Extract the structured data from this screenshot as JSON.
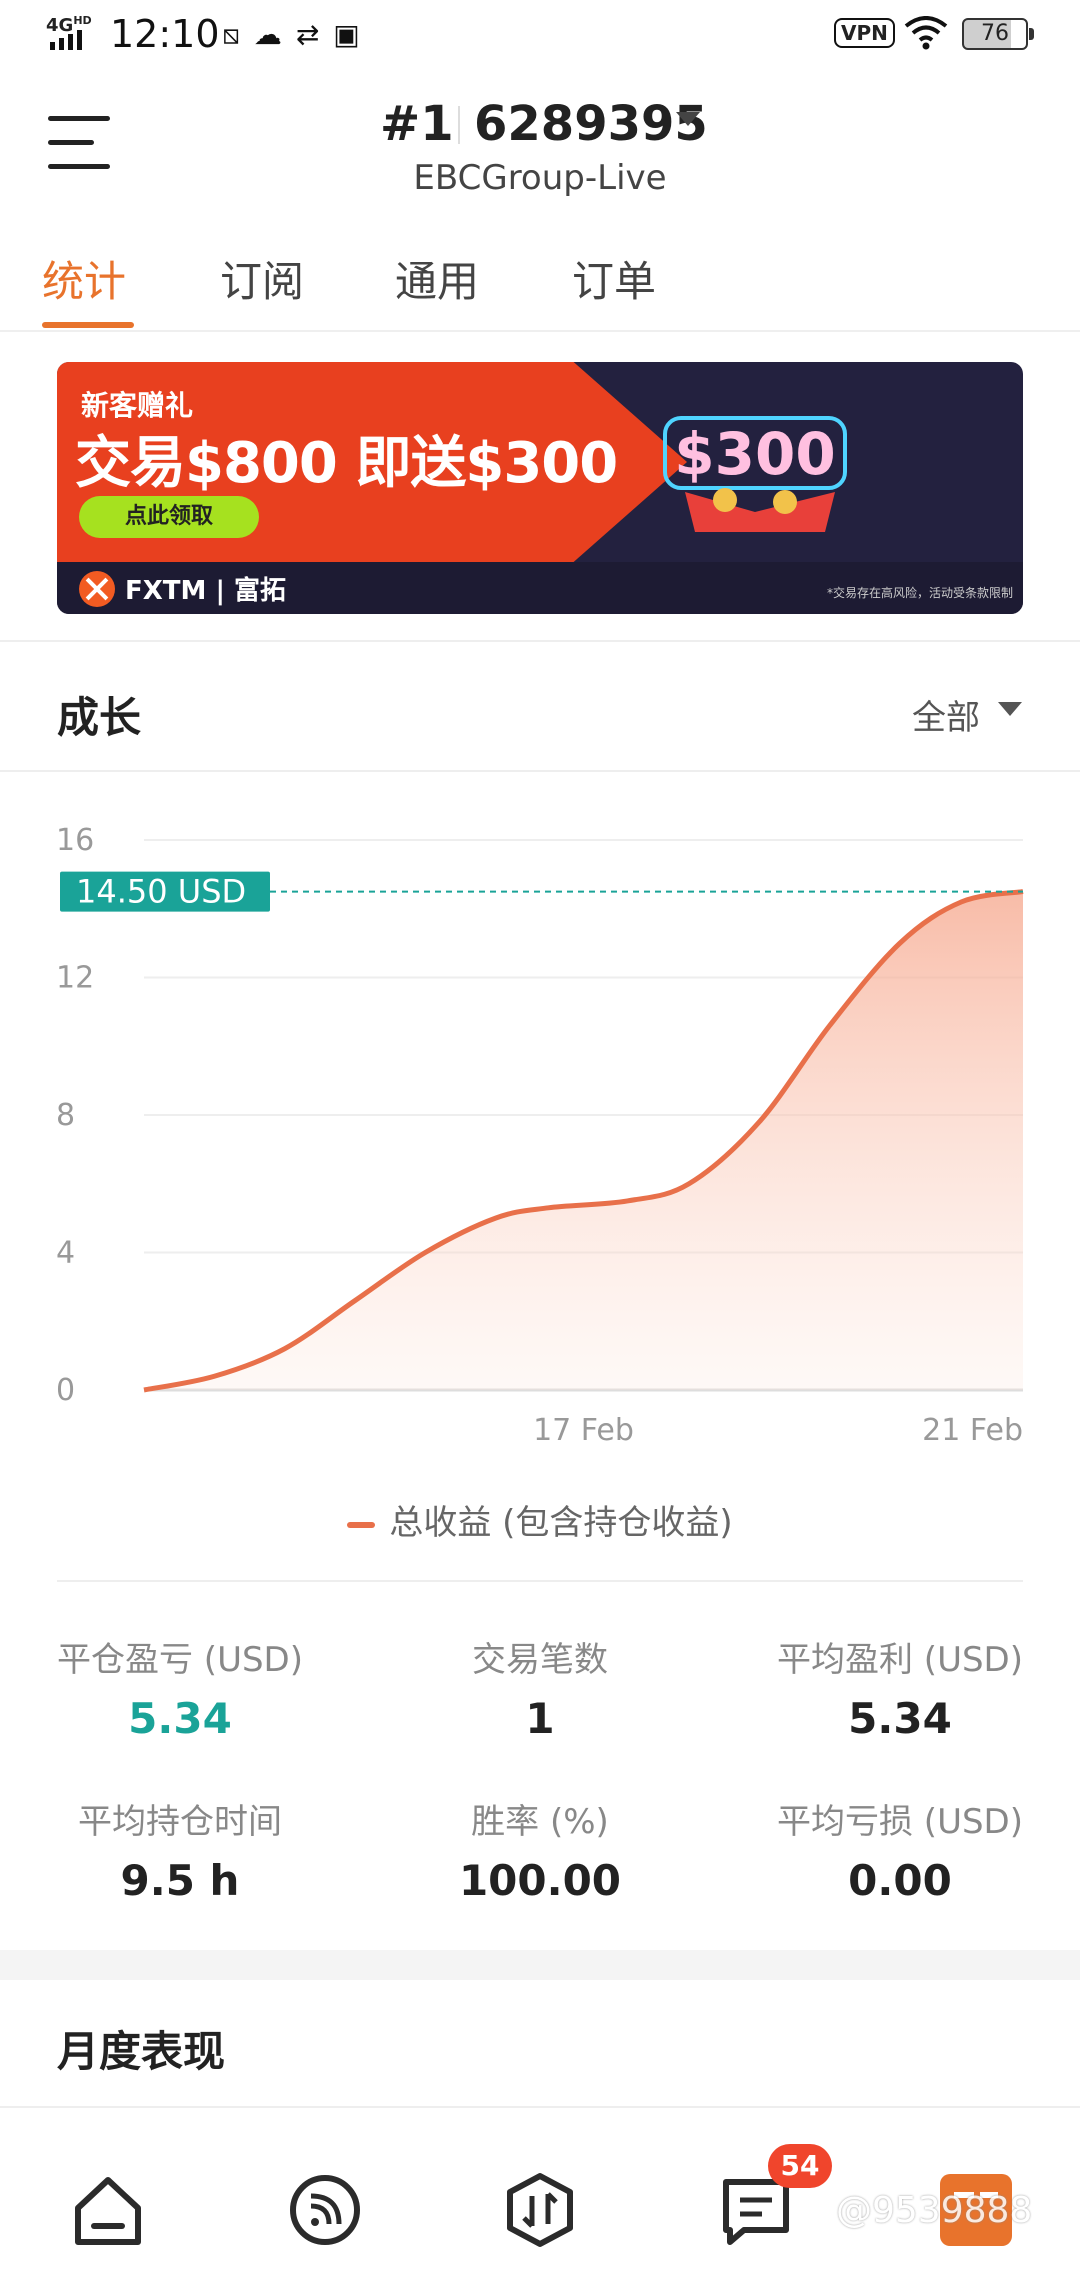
{
  "status_bar": {
    "network": "4G",
    "network_sup": "HD",
    "time": "12:10",
    "vpn": "VPN",
    "battery": "76"
  },
  "header": {
    "account_number": "#1",
    "account_id": "6289395",
    "server": "EBCGroup-Live"
  },
  "tabs": [
    {
      "label": "统计",
      "active": true
    },
    {
      "label": "订阅",
      "active": false
    },
    {
      "label": "通用",
      "active": false
    },
    {
      "label": "订单",
      "active": false
    }
  ],
  "banner": {
    "line1": "新客赠礼",
    "line2": "交易$800 即送$300",
    "button": "点此领取",
    "brand": "FXTM | 富拓",
    "prize": "$300",
    "note": "*交易存在高风险，活动受条款限制"
  },
  "growth": {
    "title": "成长",
    "filter": "全部"
  },
  "chart_data": {
    "type": "area",
    "series": [
      {
        "name": "总收益 (包含持仓收益)",
        "points": [
          {
            "x": 0.0,
            "y": 0.0
          },
          {
            "x": 0.08,
            "y": 0.4
          },
          {
            "x": 0.16,
            "y": 1.2
          },
          {
            "x": 0.24,
            "y": 2.6
          },
          {
            "x": 0.32,
            "y": 4.0
          },
          {
            "x": 0.4,
            "y": 5.0
          },
          {
            "x": 0.46,
            "y": 5.3
          },
          {
            "x": 0.55,
            "y": 5.5
          },
          {
            "x": 0.62,
            "y": 6.0
          },
          {
            "x": 0.7,
            "y": 7.8
          },
          {
            "x": 0.78,
            "y": 10.6
          },
          {
            "x": 0.86,
            "y": 13.0
          },
          {
            "x": 0.93,
            "y": 14.2
          },
          {
            "x": 1.0,
            "y": 14.5
          }
        ]
      }
    ],
    "xticks": [
      {
        "pos": 0.5,
        "label": "17 Feb"
      },
      {
        "pos": 1.0,
        "label": "21 Feb"
      }
    ],
    "yticks": [
      0,
      4,
      8,
      12,
      16
    ],
    "ylim": [
      0,
      16
    ],
    "current_value": 14.5,
    "current_label": "14.50 USD",
    "line_color": "#e8704a",
    "marker_color": "#1aa398",
    "grid": true,
    "legend": "bottom"
  },
  "legend_label": "总收益 (包含持仓收益)",
  "stats": {
    "closed_pnl_label": "平仓盈亏 (USD)",
    "closed_pnl_value": "5.34",
    "trades_label": "交易笔数",
    "trades_value": "1",
    "avg_profit_label": "平均盈利 (USD)",
    "avg_profit_value": "5.34",
    "avg_hold_label": "平均持仓时间",
    "avg_hold_value": "9.5 h",
    "win_rate_label": "胜率 (%)",
    "win_rate_value": "100.00",
    "avg_loss_label": "平均亏损 (USD)",
    "avg_loss_value": "0.00"
  },
  "monthly": {
    "title": "月度表现"
  },
  "bottom_nav": {
    "badge": "54",
    "watermark": "@9539888",
    "icons": [
      "home-icon",
      "feed-icon",
      "trade-icon",
      "messages-icon",
      "profile-icon"
    ]
  },
  "colors": {
    "accent": "#e8732c",
    "green": "#1aa398",
    "badge": "#f0452c"
  }
}
